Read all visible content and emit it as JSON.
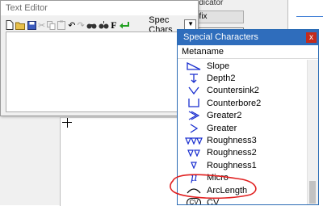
{
  "background": {
    "label_text": "Indicator",
    "tab_text": "bfix"
  },
  "text_editor": {
    "title": "Text Editor",
    "spec_chars_label": "Spec Chars",
    "icons": [
      "new-icon",
      "open-icon",
      "save-icon",
      "cut-icon",
      "copy-icon",
      "paste-icon",
      "undo-icon",
      "redo-icon",
      "find-icon",
      "replace-icon",
      "font-icon",
      "insert-icon"
    ]
  },
  "special_characters": {
    "title": "Special Characters",
    "close_label": "x",
    "column_header": "Metaname",
    "items": [
      {
        "label": "Slope",
        "icon": "slope-icon"
      },
      {
        "label": "Depth2",
        "icon": "depth-icon"
      },
      {
        "label": "Countersink2",
        "icon": "countersink-icon"
      },
      {
        "label": "Counterbore2",
        "icon": "counterbore-icon"
      },
      {
        "label": "Greater2",
        "icon": "greater2-icon"
      },
      {
        "label": "Greater",
        "icon": "greater-icon"
      },
      {
        "label": "Roughness3",
        "icon": "roughness3-icon"
      },
      {
        "label": "Roughness2",
        "icon": "roughness2-icon"
      },
      {
        "label": "Roughness1",
        "icon": "roughness1-icon"
      },
      {
        "label": "Micro",
        "icon": "micro-icon"
      },
      {
        "label": "ArcLength",
        "icon": "arclength-icon"
      },
      {
        "label": "CV",
        "icon": "cv-icon"
      }
    ],
    "micro_glyph": "μ",
    "cv_glyph": "CV"
  },
  "colors": {
    "titlebar": "#2f6dbc",
    "symbol": "#1a2fcf",
    "annotation": "#e02020"
  }
}
